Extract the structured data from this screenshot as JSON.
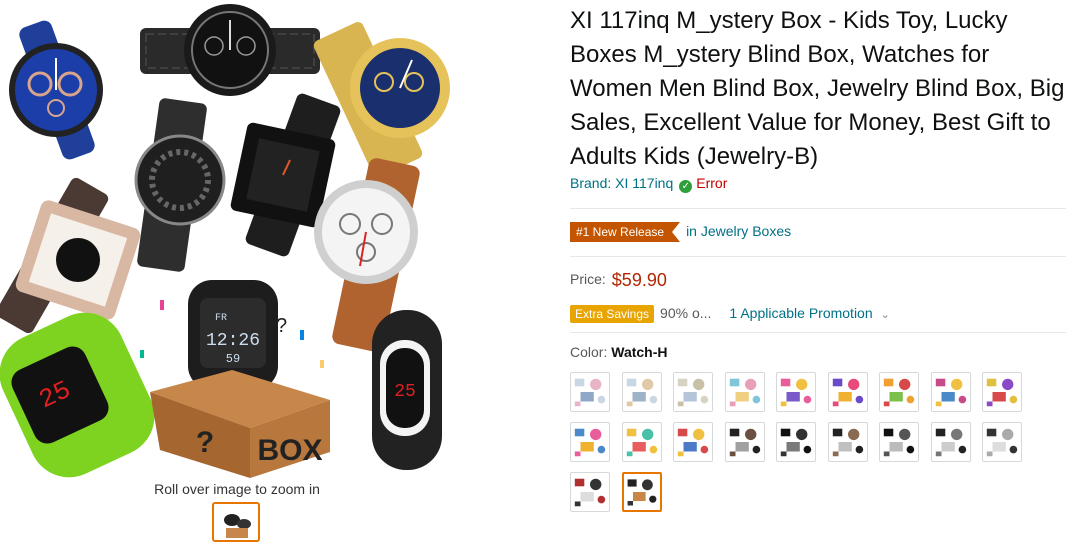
{
  "product": {
    "title": "XI 117inq M_ystery Box - Kids Toy, Lucky Boxes M_ystery Blind Box, Watches for Women Men Blind Box, Jewelry Blind Box, Big Sales, Excellent Value for Money, Best Gift to Adults Kids (Jewelry-B)",
    "brand_link": "Brand: XI 117inq",
    "brand_status_icon": "check-circle-icon",
    "brand_status": "Error"
  },
  "ranking": {
    "badge": "#1 New Release",
    "category_link": "in Jewelry Boxes"
  },
  "price": {
    "label": "Price:",
    "value": "$59.90"
  },
  "promotion": {
    "badge": "Extra Savings",
    "percent_text": "90% o...",
    "link": "1 Applicable Promotion",
    "chevron_icon": "chevron-down-icon"
  },
  "color": {
    "label": "Color:",
    "selected": "Watch-H",
    "swatch_count": 20,
    "selected_index": 19
  },
  "gallery": {
    "zoom_hint": "Roll over image to zoom in",
    "watch_faces": {
      "fr_label": "FR",
      "time_label": "12:26",
      "seconds_label": "59",
      "red_digits_1": "25",
      "red_digits_2": "25"
    },
    "box_text": "BOX"
  },
  "colors": {
    "link": "#007185",
    "price": "#B12704",
    "badge": "#C45500",
    "extra_savings": "#E8A400",
    "error": "#C40000",
    "selected_border": "#E77600"
  }
}
